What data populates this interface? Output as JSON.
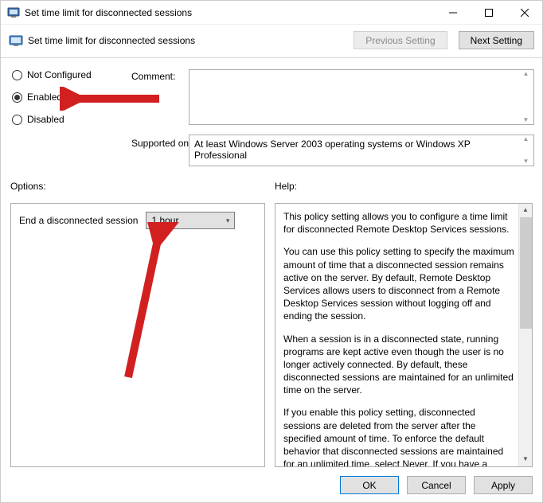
{
  "window": {
    "title": "Set time limit for disconnected sessions"
  },
  "header": {
    "title": "Set time limit for disconnected sessions",
    "prev_label": "Previous Setting",
    "next_label": "Next Setting"
  },
  "state": {
    "not_configured": "Not Configured",
    "enabled": "Enabled",
    "disabled": "Disabled",
    "selected": "enabled",
    "comment_label": "Comment:",
    "supported_label": "Supported on:",
    "supported_text": "At least Windows Server 2003 operating systems or Windows XP Professional"
  },
  "sections": {
    "options_label": "Options:",
    "help_label": "Help:"
  },
  "options": {
    "end_session_label": "End a disconnected session",
    "end_session_value": "1 hour"
  },
  "help": {
    "p1": "This policy setting allows you to configure a time limit for disconnected Remote Desktop Services sessions.",
    "p2": "You can use this policy setting to specify the maximum amount of time that a disconnected session remains active on the server. By default, Remote Desktop Services allows users to disconnect from a Remote Desktop Services session without logging off and ending the session.",
    "p3": "When a session is in a disconnected state, running programs are kept active even though the user is no longer actively connected. By default, these disconnected sessions are maintained for an unlimited time on the server.",
    "p4": "If you enable this policy setting, disconnected sessions are deleted from the server after the specified amount of time. To enforce the default behavior that disconnected sessions are maintained for an unlimited time, select Never. If you have a console session, disconnected session time limits do not apply."
  },
  "footer": {
    "ok": "OK",
    "cancel": "Cancel",
    "apply": "Apply"
  },
  "colors": {
    "arrow": "#d22020"
  }
}
